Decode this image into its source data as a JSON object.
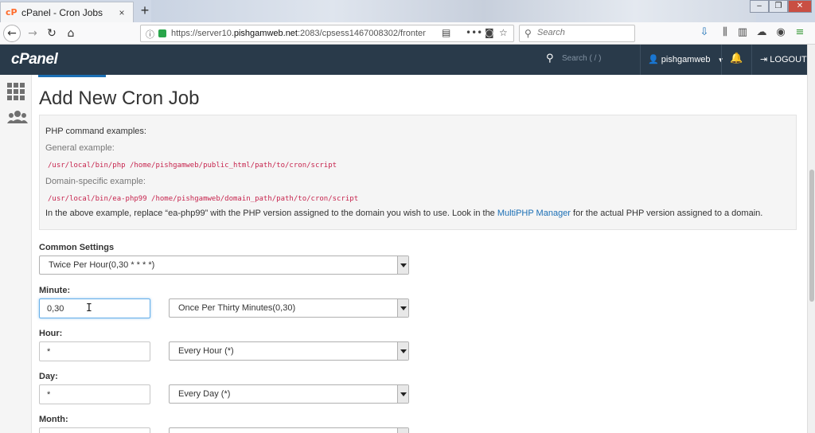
{
  "browser": {
    "tab_title": "cPanel - Cron Jobs",
    "tab_close": "×",
    "new_tab": "+",
    "url_prefix": "https://server10.",
    "url_domain": "pishgamweb.net",
    "url_rest": ":2083/cpsess1467008302/fronten",
    "search_placeholder": "Search"
  },
  "cpanel": {
    "logo": "cPanel",
    "search_placeholder": "Search ( / )",
    "username": "pishgamweb",
    "logout": "LOGOUT"
  },
  "page": {
    "title": "Add New Cron Job",
    "examples": {
      "heading": "PHP command examples:",
      "general_label": "General example:",
      "general_code": "/usr/local/bin/php /home/pishgamweb/public_html/path/to/cron/script",
      "domain_label": "Domain-specific example:",
      "domain_code": "/usr/local/bin/ea-php99 /home/pishgamweb/domain_path/path/to/cron/script",
      "note_before": "In the above example, replace “ea-php99” with the PHP version assigned to the domain you wish to use. Look in the ",
      "note_link": "MultiPHP Manager",
      "note_after": " for the actual PHP version assigned to a domain."
    },
    "common_settings": {
      "label": "Common Settings",
      "selected": "Twice Per Hour(0,30 * * * *)"
    },
    "minute": {
      "label": "Minute:",
      "value": "0,30",
      "selected": "Once Per Thirty Minutes(0,30)"
    },
    "hour": {
      "label": "Hour:",
      "value": "*",
      "selected": "Every Hour (*)"
    },
    "day": {
      "label": "Day:",
      "value": "*",
      "selected": "Every Day (*)"
    },
    "month": {
      "label": "Month:"
    }
  }
}
